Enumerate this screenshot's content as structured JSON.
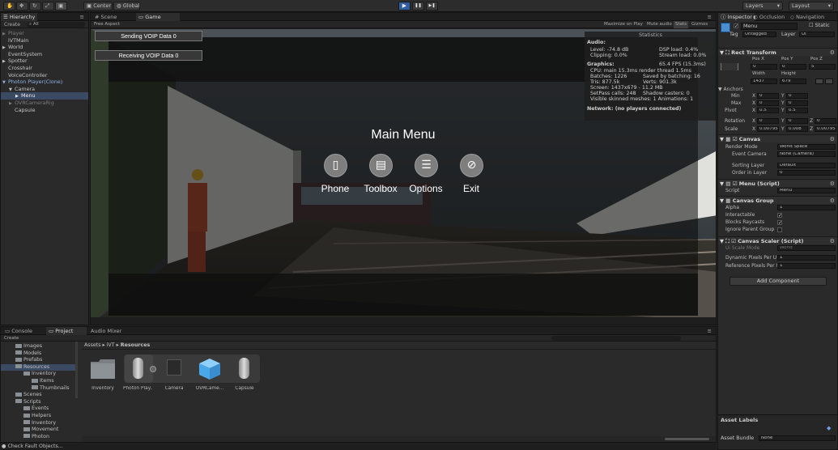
{
  "toolbar": {
    "pivot_label": "Center",
    "space_label": "Global",
    "layers_label": "Layers",
    "layout_label": "Layout",
    "play_glyph": "▶",
    "pause_glyph": "❚❚",
    "step_glyph": "▶❚"
  },
  "hierarchy": {
    "tab": "Hierarchy",
    "create": "Create",
    "search": "All",
    "items": [
      {
        "label": "Player",
        "dim": true,
        "arrow": "▶"
      },
      {
        "label": "iVTMain",
        "dim": false,
        "arrow": ""
      },
      {
        "label": "World",
        "dim": false,
        "arrow": "▶"
      },
      {
        "label": "EventSystem",
        "dim": false,
        "arrow": ""
      },
      {
        "label": "Spotter",
        "dim": false,
        "arrow": "▶"
      },
      {
        "label": "Crosshair",
        "dim": false,
        "arrow": ""
      },
      {
        "label": "VoiceController",
        "dim": false,
        "arrow": ""
      },
      {
        "label": "Photon Player(Clone)",
        "dim": false,
        "arrow": "▼"
      },
      {
        "label": "Camera",
        "dim": false,
        "arrow": "▼"
      },
      {
        "label": "Menu",
        "dim": false,
        "arrow": "▶"
      },
      {
        "label": "OVRCameraRig",
        "dim": true,
        "arrow": "▶"
      },
      {
        "label": "Capsule",
        "dim": false,
        "arrow": ""
      }
    ]
  },
  "scene_tabs": {
    "scene": "Scene",
    "game": "Game",
    "aspect": "Free Aspect",
    "maximize": "Maximize on Play",
    "mute": "Mute audio",
    "stats": "Stats",
    "gizmos": "Gizmos"
  },
  "game": {
    "voip_send": "Sending VOIP Data 0",
    "voip_receive": "Receiving VOIP Data 0",
    "main_menu_title": "Main Menu",
    "menu_items": [
      {
        "label": "Phone",
        "icon": "phone-icon"
      },
      {
        "label": "Toolbox",
        "icon": "toolbox-icon"
      },
      {
        "label": "Options",
        "icon": "options-icon"
      },
      {
        "label": "Exit",
        "icon": "exit-icon"
      }
    ]
  },
  "statistics": {
    "title": "Statistics",
    "audio_heading": "Audio:",
    "level": "Level: -74.8 dB",
    "clipping": "Clipping: 0.0%",
    "dsp_load": "DSP load: 0.4%",
    "stream_load": "Stream load: 0.0%",
    "graphics_heading": "Graphics:",
    "fps": "65.4 FPS (15.3ms)",
    "cpu": "CPU: main 15.3ms  render thread 1.5ms",
    "batches": "Batches: 1226",
    "saved_batching": "Saved by batching: 16",
    "tris": "Tris: 877.5k",
    "verts": "Verts: 901.3k",
    "screen": "Screen: 1437x679 - 11.2 MB",
    "setpass": "SetPass calls: 248",
    "shadow": "Shadow casters: 0",
    "skinned": "Visible skinned meshes: 1  Animations: 1",
    "network": "Network: (no players connected)"
  },
  "inspector": {
    "tab": "Inspector",
    "tab2": "Occlusion",
    "tab3": "Navigation",
    "object_name": "Menu",
    "static": "Static",
    "tag_label": "Tag",
    "tag_value": "Untagged",
    "layer_label": "Layer",
    "layer_value": "UI",
    "rect_transform": "Rect Transform",
    "pos_x_label": "Pos X",
    "pos_y_label": "Pos Y",
    "pos_z_label": "Pos Z",
    "pos_x": "0",
    "pos_y": "0",
    "pos_z": "5",
    "width_label": "Width",
    "height_label": "Height",
    "width": "1437",
    "height": "679",
    "anchors": "Anchors",
    "min_label": "Min",
    "max_label": "Max",
    "min_x": "0",
    "min_y": "0",
    "max_x": "0",
    "max_y": "0",
    "pivot_label": "Pivot",
    "pivot_x": "0.5",
    "pivot_y": "0.5",
    "rotation_label": "Rotation",
    "rot_x": "0",
    "rot_y": "0",
    "rot_z": "0",
    "scale_label": "Scale",
    "scale_x": "0.00795",
    "scale_y": "0.008",
    "scale_z": "0.00795",
    "x": "X",
    "y": "Y",
    "z": "Z",
    "canvas": "Canvas",
    "render_mode_label": "Render Mode",
    "render_mode": "World Space",
    "event_camera_label": "Event Camera",
    "event_camera": "None (Camera)",
    "sorting_layer_label": "Sorting Layer",
    "sorting_layer": "Default",
    "order_label": "Order in Layer",
    "order": "0",
    "menu_script": "Menu (Script)",
    "script_label": "Script",
    "script_value": "Menu",
    "canvas_group": "Canvas Group",
    "alpha_label": "Alpha",
    "alpha": "1",
    "interactable_label": "Interactable",
    "blocks_label": "Blocks Raycasts",
    "ignore_label": "Ignore Parent Group",
    "canvas_scaler": "Canvas Scaler (Script)",
    "ui_scale_label": "Ui Scale Mode",
    "ui_scale": "World",
    "dynamic_label": "Dynamic Pixels Per U",
    "dynamic": "1",
    "reference_label": "Reference Pixels Per U",
    "reference": "1",
    "add_component": "Add Component",
    "asset_labels": "Asset Labels",
    "asset_bundle_label": "Asset Bundle",
    "asset_bundle": "None"
  },
  "project": {
    "tabs": [
      "Console",
      "Project",
      "Audio Mixer"
    ],
    "create": "Create",
    "breadcrumb": [
      "Assets",
      "iVT",
      "Resources"
    ],
    "tree": [
      {
        "label": "Images",
        "indent": 1
      },
      {
        "label": "Models",
        "indent": 1
      },
      {
        "label": "Prefabs",
        "indent": 1
      },
      {
        "label": "Resources",
        "indent": 1
      },
      {
        "label": "Inventory",
        "indent": 2
      },
      {
        "label": "Items",
        "indent": 3
      },
      {
        "label": "Thumbnails",
        "indent": 3
      },
      {
        "label": "Scenes",
        "indent": 1
      },
      {
        "label": "Scripts",
        "indent": 1
      },
      {
        "label": "Events",
        "indent": 2
      },
      {
        "label": "Helpers",
        "indent": 2
      },
      {
        "label": "Inventory",
        "indent": 2
      },
      {
        "label": "Movement",
        "indent": 2
      },
      {
        "label": "Photon",
        "indent": 2
      }
    ],
    "assets": [
      "Inventory",
      "Photon Play...",
      "Camera",
      "OVRCame...",
      "Capsule"
    ]
  },
  "status_bar": "Check Fault Objects..."
}
